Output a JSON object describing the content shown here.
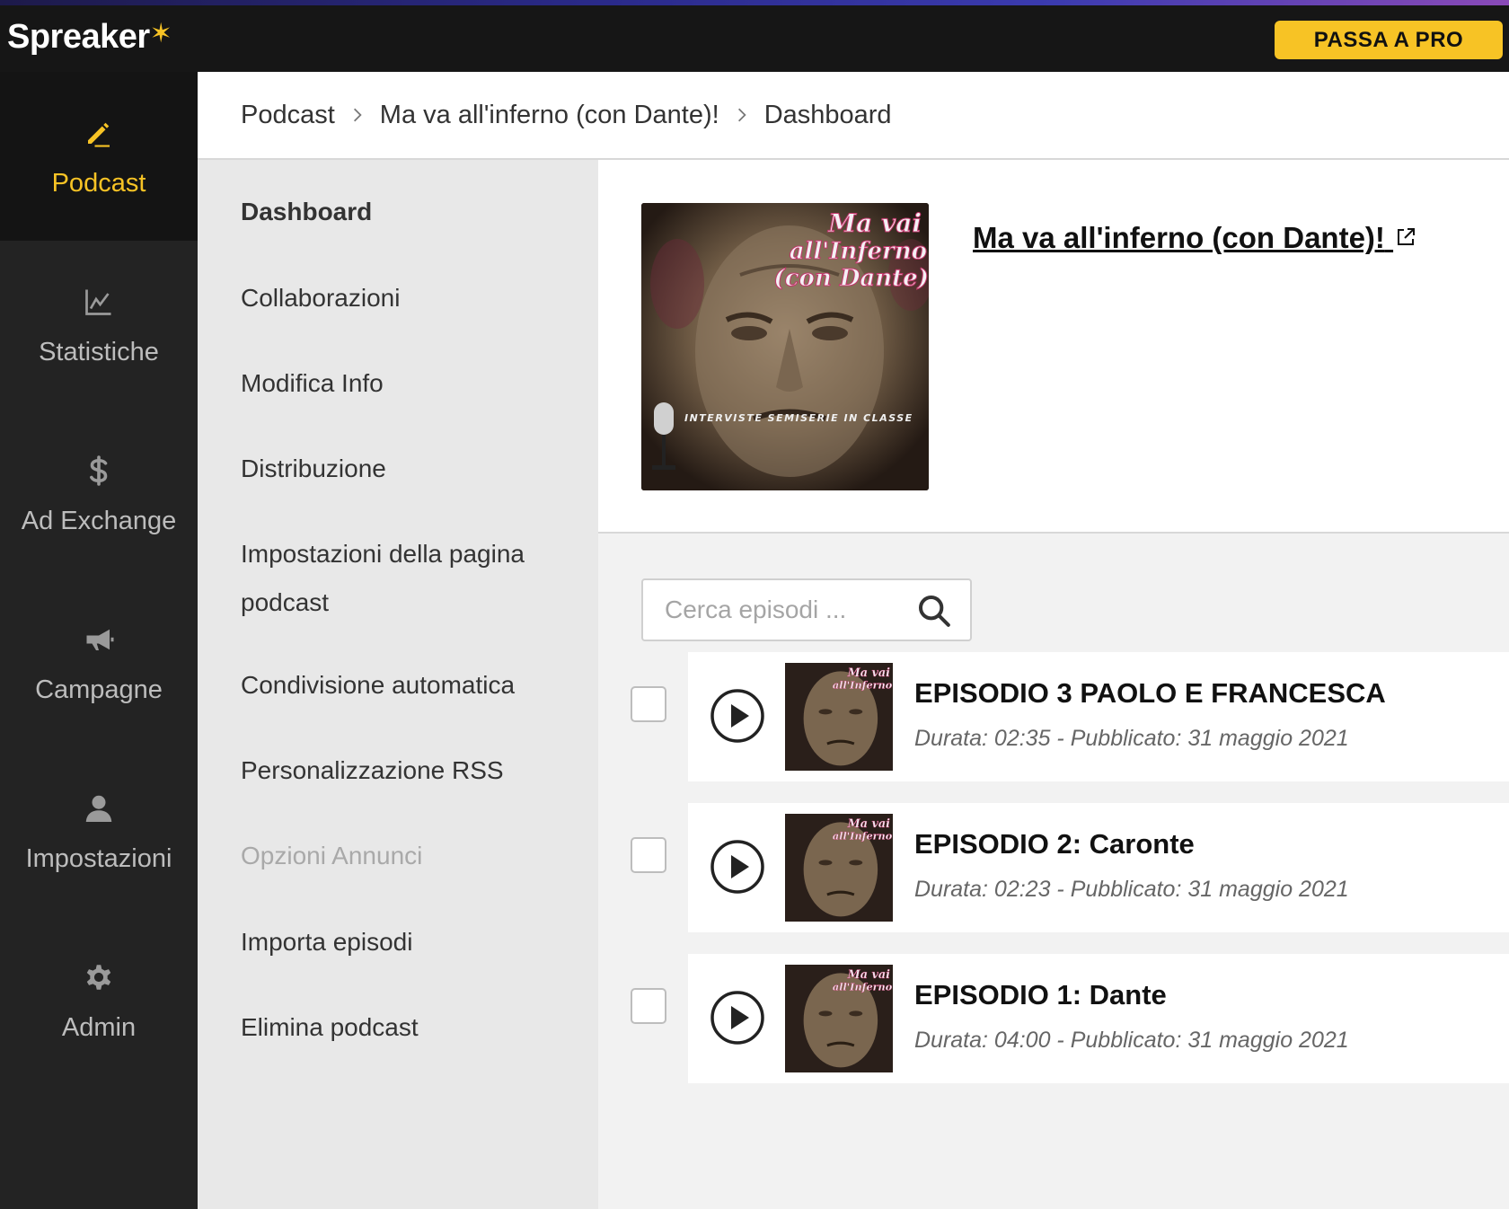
{
  "topbar": {
    "logo": "Spreaker",
    "logo_star": "✶",
    "pro_button": "PASSA A PRO"
  },
  "nav": [
    {
      "label": "Podcast",
      "icon": "pencil-icon",
      "active": true
    },
    {
      "label": "Statistiche",
      "icon": "chart-icon"
    },
    {
      "label": "Ad Exchange",
      "icon": "dollar-icon"
    },
    {
      "label": "Campagne",
      "icon": "megaphone-icon"
    },
    {
      "label": "Impostazioni",
      "icon": "user-icon"
    },
    {
      "label": "Admin",
      "icon": "gear-icon"
    }
  ],
  "breadcrumb": [
    "Podcast",
    "Ma va all'inferno (con Dante)!",
    "Dashboard"
  ],
  "submenu": [
    {
      "label": "Dashboard",
      "state": "active"
    },
    {
      "label": "Collaborazioni"
    },
    {
      "label": "Modifica Info"
    },
    {
      "label": "Distribuzione"
    },
    {
      "label": "Impostazioni della pagina podcast"
    },
    {
      "label": "Condivisione automatica"
    },
    {
      "label": "Personalizzazione RSS"
    },
    {
      "label": "Opzioni Annunci",
      "state": "disabled"
    },
    {
      "label": "Importa episodi"
    },
    {
      "label": "Elimina podcast"
    }
  ],
  "podcast": {
    "title": "Ma va all'inferno (con Dante)!",
    "cover_title": "Ma vai all'Inferno (con Dante)",
    "cover_subtitle": "INTERVISTE SEMISERIE IN CLASSE"
  },
  "search": {
    "placeholder": "Cerca episodi ..."
  },
  "episodes": [
    {
      "title": "EPISODIO 3 PAOLO E FRANCESCA",
      "meta": "Durata: 02:35 - Pubblicato: 31 maggio 2021"
    },
    {
      "title": "EPISODIO 2: Caronte",
      "meta": "Durata: 02:23 - Pubblicato: 31 maggio 2021"
    },
    {
      "title": "EPISODIO 1: Dante",
      "meta": "Durata: 04:00 - Pubblicato: 31 maggio 2021"
    }
  ],
  "colors": {
    "accent": "#f7c325",
    "topbar": "#161616",
    "sidebar": "#232323",
    "submenu": "#e8e8e8"
  }
}
